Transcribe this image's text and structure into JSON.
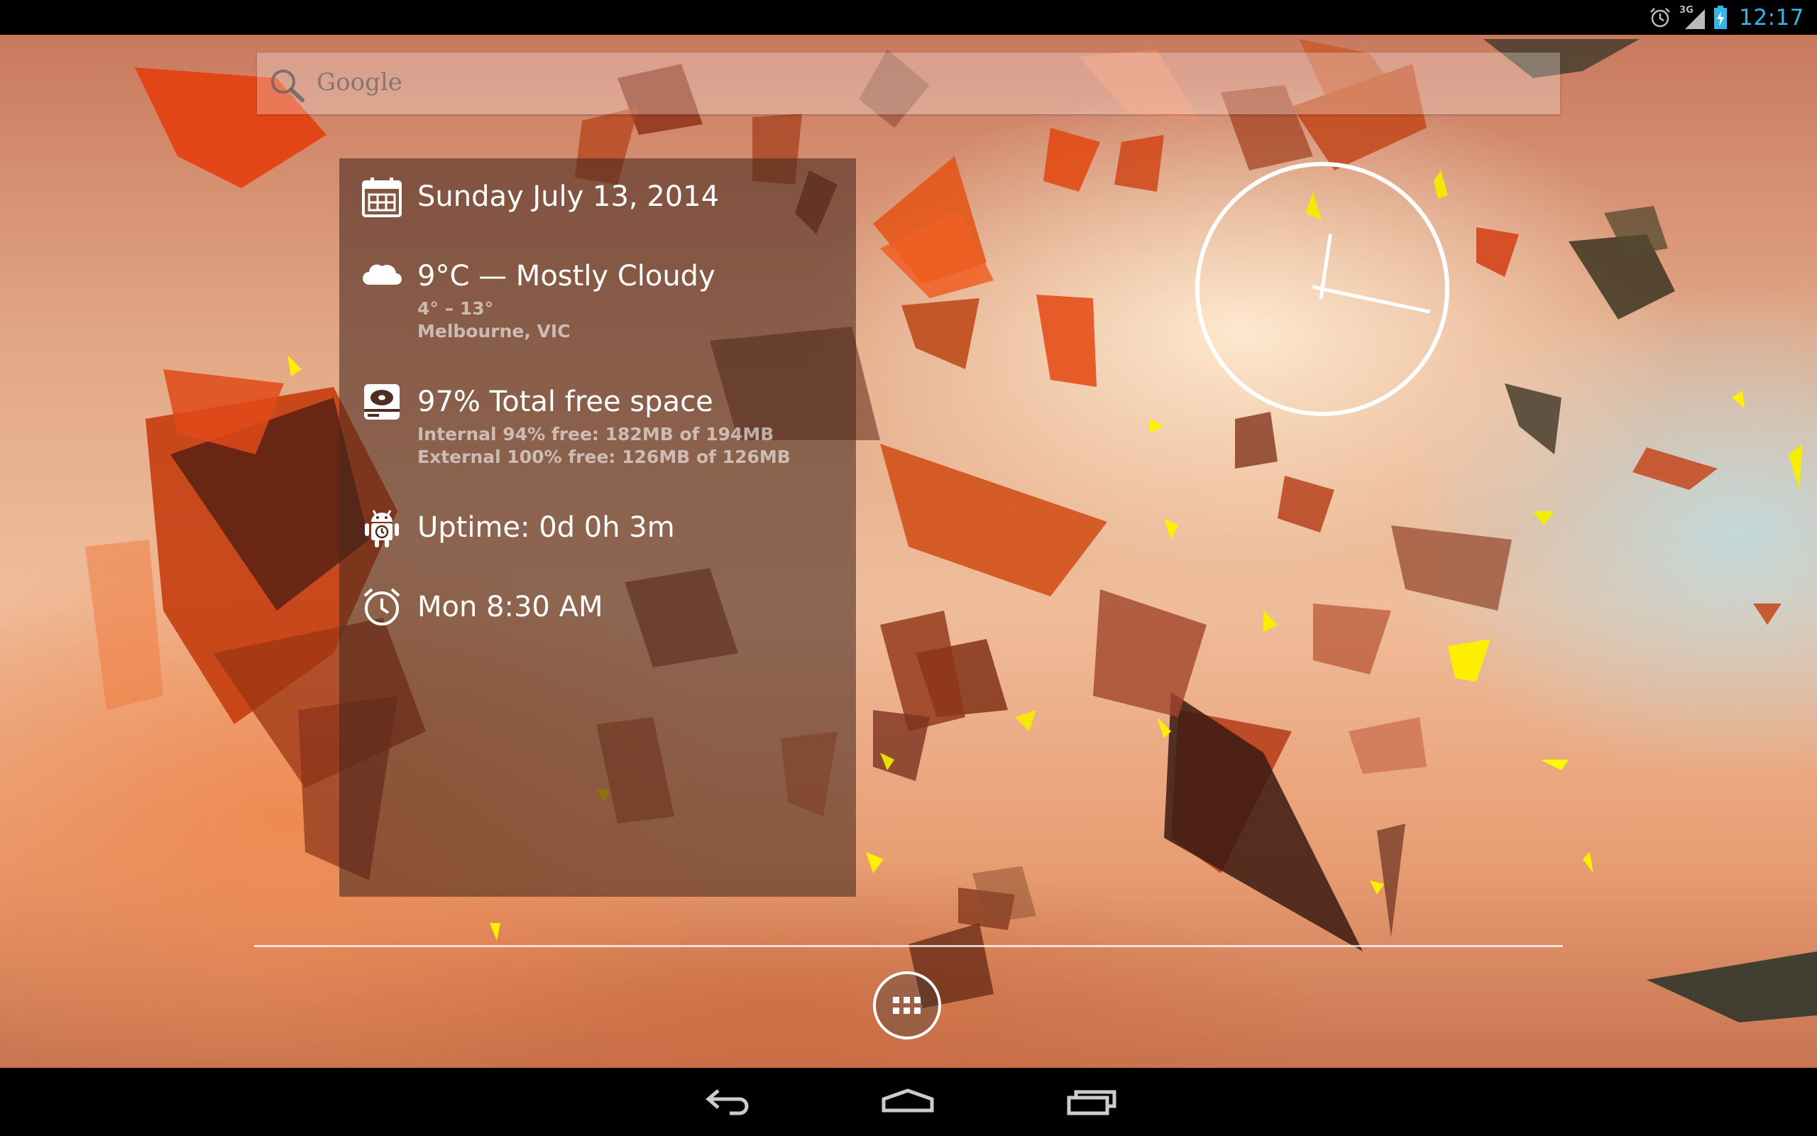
{
  "status_bar": {
    "network_label": "3G",
    "time": "12:17",
    "icons": [
      "alarm-icon",
      "signal-icon",
      "battery-charging-icon"
    ],
    "time_color": "#33b5e5"
  },
  "search": {
    "placeholder": "Google",
    "icon": "search-icon"
  },
  "info_widget": {
    "date": {
      "icon": "calendar-icon",
      "text": "Sunday July 13, 2014"
    },
    "weather": {
      "icon": "cloud-icon",
      "text": "9°C — Mostly Cloudy",
      "range": "4° – 13°",
      "location": "Melbourne, VIC"
    },
    "storage": {
      "icon": "storage-icon",
      "text": "97% Total free space",
      "internal": "Internal 94% free: 182MB of 194MB",
      "external": "External 100% free: 126MB of 126MB"
    },
    "uptime": {
      "icon": "android-uptime-icon",
      "text": "Uptime: 0d 0h 3m"
    },
    "alarm": {
      "icon": "alarm-clock-icon",
      "text": "Mon 8:30 AM"
    }
  },
  "analog_clock": {
    "hour": 12,
    "minute": 17
  },
  "dock": {
    "app_drawer_icon": "apps-grid-icon"
  },
  "nav_bar": {
    "back_icon": "back-icon",
    "home_icon": "home-icon",
    "recents_icon": "recents-icon"
  }
}
